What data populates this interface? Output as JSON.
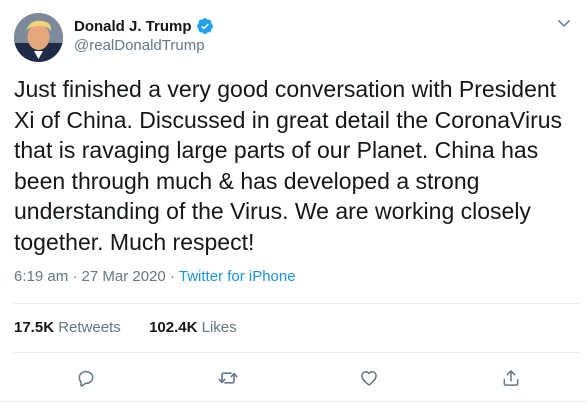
{
  "author": {
    "display_name": "Donald J. Trump",
    "handle": "@realDonaldTrump",
    "verified": true
  },
  "tweet": {
    "text": "Just finished a very good conversation with President Xi of China. Discussed in great detail the CoronaVirus that is ravaging large parts of our Planet. China has been through much & has developed a strong understanding of the Virus. We are working closely together. Much respect!",
    "time": "6:19 am",
    "separator": "·",
    "date": "27 Mar 2020",
    "source": "Twitter for iPhone"
  },
  "stats": {
    "retweets_count": "17.5K",
    "retweets_label": "Retweets",
    "likes_count": "102.4K",
    "likes_label": "Likes"
  },
  "colors": {
    "text": "#14171a",
    "muted": "#657786",
    "accent": "#1b95e0",
    "border": "#e6ecf0"
  },
  "icons": {
    "verified": "verified-badge-icon",
    "caret": "chevron-down-icon",
    "reply": "reply-icon",
    "retweet": "retweet-icon",
    "like": "heart-icon",
    "share": "share-icon"
  }
}
